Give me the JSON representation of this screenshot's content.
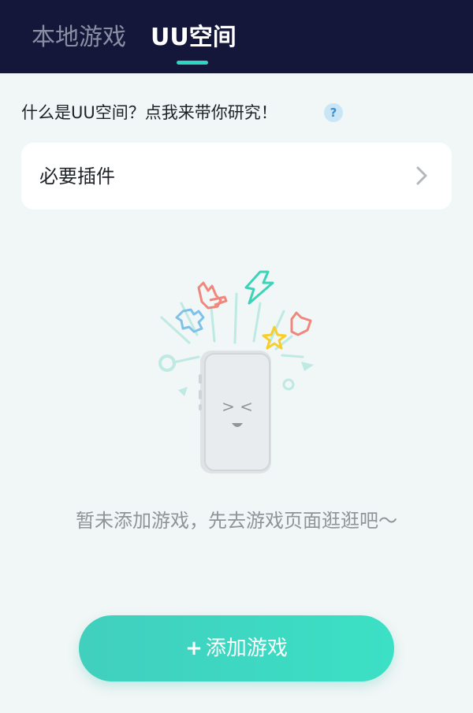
{
  "tabs": {
    "local": "本地游戏",
    "uu_space": "UU空间"
  },
  "intro": {
    "text": "什么是UU空间？点我来带你研究！",
    "help_icon": "?"
  },
  "plugin": {
    "label": "必要插件",
    "arrow_icon": "chevron-right-icon"
  },
  "empty_state": {
    "message": "暂未添加游戏，先去游戏页面逛逛吧～",
    "illustration_face": "> <"
  },
  "add_button": {
    "plus": "+",
    "label": "添加游戏"
  },
  "colors": {
    "header_bg": "#15173a",
    "accent": "#2cd6c0",
    "page_bg": "#f1f6f6",
    "button_gradient_start": "#41cfbe",
    "button_gradient_end": "#3be0c5"
  }
}
